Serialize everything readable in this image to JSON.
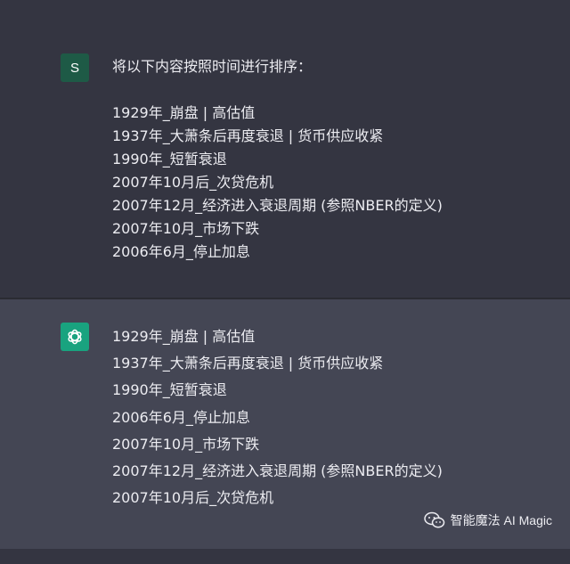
{
  "user_message": {
    "avatar_letter": "S",
    "prompt": "将以下内容按照时间进行排序：",
    "items": [
      "1929年_崩盘 | 高估值",
      "1937年_大萧条后再度衰退 | 货币供应收紧",
      "1990年_短暂衰退",
      "2007年10月后_次贷危机",
      "2007年12月_经济进入衰退周期 (参照NBER的定义)",
      "2007年10月_市场下跌",
      "2006年6月_停止加息"
    ]
  },
  "assistant_message": {
    "icon": "openai-logo-icon",
    "items": [
      "1929年_崩盘 | 高估值",
      "1937年_大萧条后再度衰退 | 货币供应收紧",
      "1990年_短暂衰退",
      "2006年6月_停止加息",
      "2007年10月_市场下跌",
      "2007年12月_经济进入衰退周期 (参照NBER的定义)",
      "2007年10月后_次贷危机"
    ]
  },
  "watermark": {
    "icon": "wechat-icon",
    "text": "智能魔法 AI Magic"
  },
  "colors": {
    "background": "#343541",
    "assistant_background": "#444654",
    "user_avatar": "#1e5a46",
    "assistant_avatar": "#19a37f",
    "text": "#ececf1"
  }
}
